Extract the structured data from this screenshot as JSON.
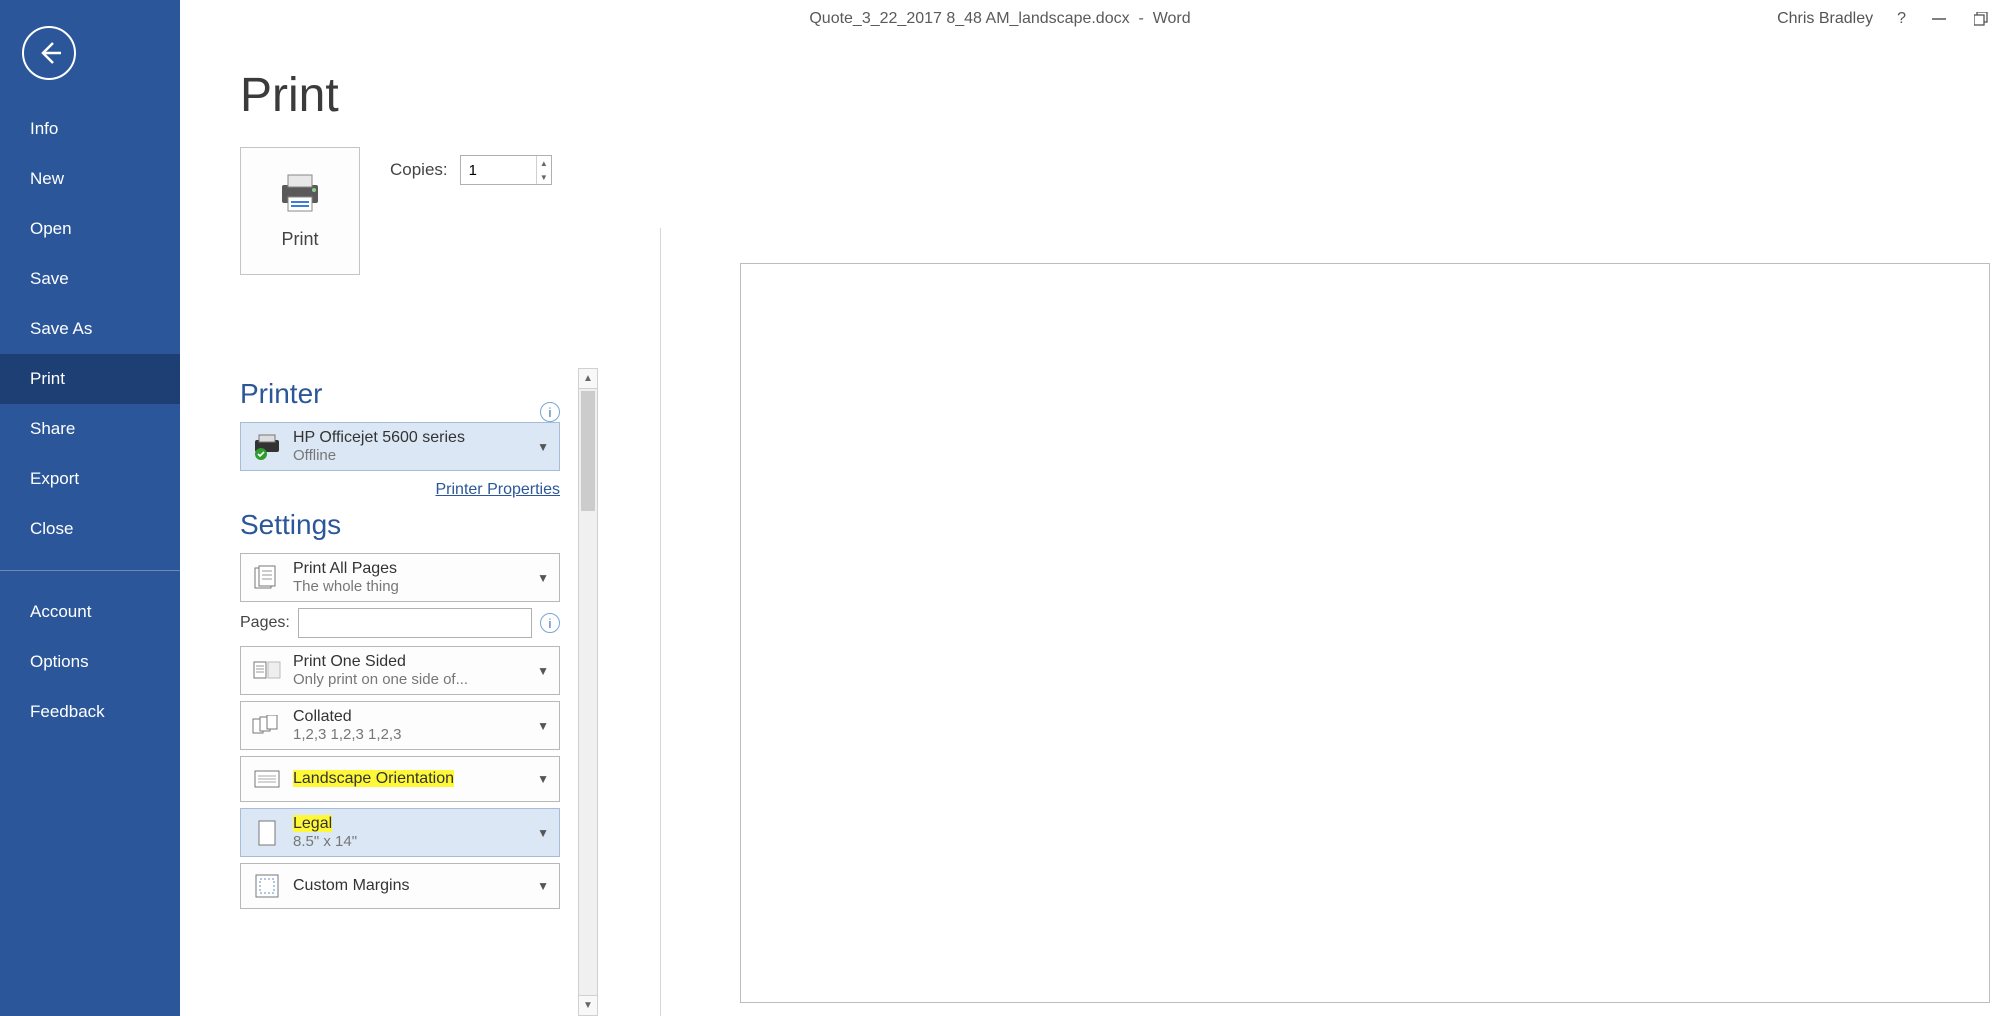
{
  "titlebar": {
    "filename": "Quote_3_22_2017 8_48 AM_landscape.docx",
    "appname": "Word",
    "user": "Chris Bradley"
  },
  "sidebar": {
    "items": [
      {
        "label": "Info",
        "selected": false
      },
      {
        "label": "New",
        "selected": false
      },
      {
        "label": "Open",
        "selected": false
      },
      {
        "label": "Save",
        "selected": false
      },
      {
        "label": "Save As",
        "selected": false
      },
      {
        "label": "Print",
        "selected": true
      },
      {
        "label": "Share",
        "selected": false
      },
      {
        "label": "Export",
        "selected": false
      },
      {
        "label": "Close",
        "selected": false
      }
    ],
    "footer": [
      {
        "label": "Account"
      },
      {
        "label": "Options"
      },
      {
        "label": "Feedback"
      }
    ]
  },
  "print": {
    "title": "Print",
    "button_label": "Print",
    "copies_label": "Copies:",
    "copies_value": "1",
    "printer_section": "Printer",
    "printer_name": "HP Officejet 5600 series",
    "printer_status": "Offline",
    "printer_properties": "Printer Properties",
    "settings_section": "Settings",
    "pages_label": "Pages:",
    "pages_value": "",
    "combos": {
      "what": {
        "primary": "Print All Pages",
        "secondary": "The whole thing"
      },
      "sides": {
        "primary": "Print One Sided",
        "secondary": "Only print on one side of..."
      },
      "collate": {
        "primary": "Collated",
        "secondary": "1,2,3    1,2,3    1,2,3"
      },
      "orientation": {
        "primary": "Landscape Orientation"
      },
      "paper": {
        "primary": "Legal",
        "secondary": "8.5\" x 14\""
      },
      "margins": {
        "primary": "Custom Margins"
      }
    }
  }
}
